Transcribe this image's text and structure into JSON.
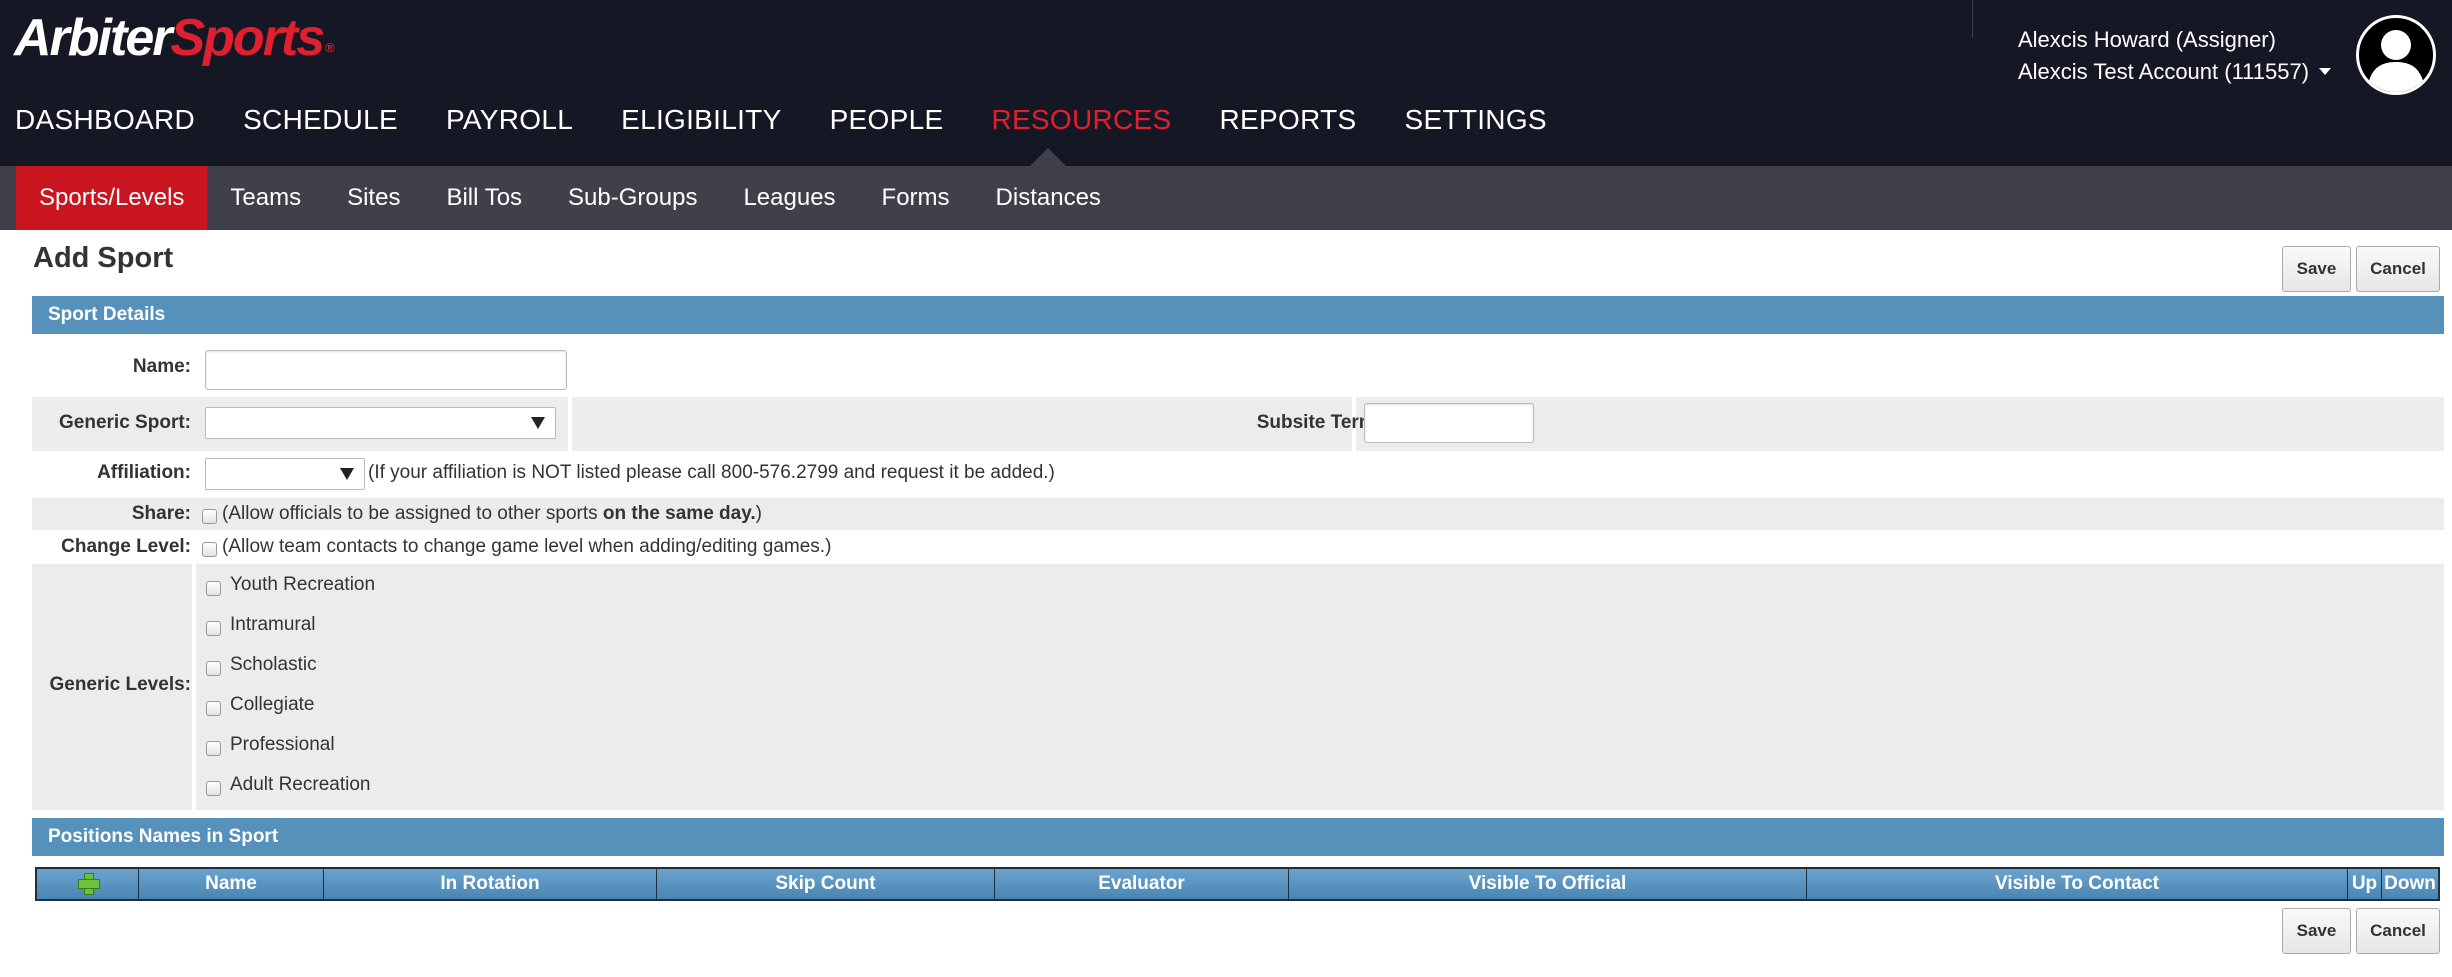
{
  "brand": {
    "part1": "Arbiter",
    "part2": "Sports",
    "tm": "®"
  },
  "user": {
    "name": "Alexcis Howard (Assigner)",
    "account": "Alexcis Test Account (111557)"
  },
  "main_nav": [
    {
      "label": "DASHBOARD",
      "active": false
    },
    {
      "label": "SCHEDULE",
      "active": false
    },
    {
      "label": "PAYROLL",
      "active": false
    },
    {
      "label": "ELIGIBILITY",
      "active": false
    },
    {
      "label": "PEOPLE",
      "active": false
    },
    {
      "label": "RESOURCES",
      "active": true
    },
    {
      "label": "REPORTS",
      "active": false
    },
    {
      "label": "SETTINGS",
      "active": false
    }
  ],
  "sub_nav": [
    {
      "label": "Sports/Levels",
      "active": true
    },
    {
      "label": "Teams",
      "active": false
    },
    {
      "label": "Sites",
      "active": false
    },
    {
      "label": "Bill Tos",
      "active": false
    },
    {
      "label": "Sub-Groups",
      "active": false
    },
    {
      "label": "Leagues",
      "active": false
    },
    {
      "label": "Forms",
      "active": false
    },
    {
      "label": "Distances",
      "active": false
    }
  ],
  "page": {
    "title": "Add Sport",
    "save_label": "Save",
    "cancel_label": "Cancel"
  },
  "sport_details": {
    "header": "Sport Details",
    "name_label": "Name:",
    "name_value": "",
    "generic_sport_label": "Generic Sport:",
    "generic_sport_value": "",
    "subsite_term_label": "Subsite Term:",
    "subsite_term_value": "",
    "affiliation_label": "Affiliation:",
    "affiliation_value": "",
    "affiliation_help": "(If your affiliation is NOT listed please call 800-576.2799 and request it be added.)",
    "share_label": "Share:",
    "share_help_prefix": "(Allow officials to be assigned to other sports ",
    "share_help_bold": "on the same day.",
    "share_help_suffix": ")",
    "change_level_label": "Change Level:",
    "change_level_help": "(Allow team contacts to change game level when adding/editing games.)",
    "generic_levels_label": "Generic Levels:",
    "generic_levels": [
      "Youth Recreation",
      "Intramural",
      "Scholastic",
      "Collegiate",
      "Professional",
      "Adult Recreation"
    ]
  },
  "positions": {
    "header": "Positions Names in Sport",
    "columns": [
      "Name",
      "In Rotation",
      "Skip Count",
      "Evaluator",
      "Visible To Official",
      "Visible To Contact",
      "Up",
      "Down"
    ]
  },
  "colors": {
    "header_bg": "#151824",
    "accent_red": "#e0202e",
    "subnav_bg": "#3f4049",
    "section_blue": "#5591bb"
  }
}
